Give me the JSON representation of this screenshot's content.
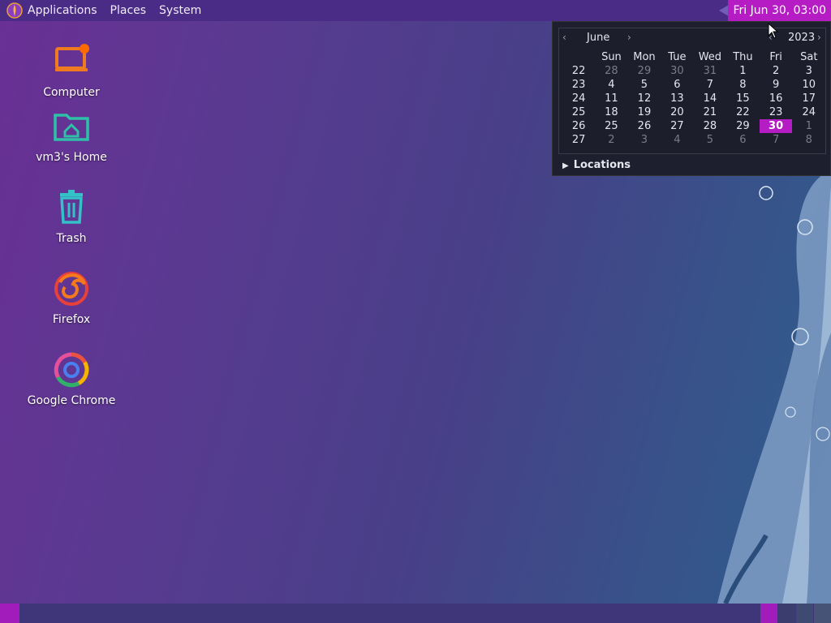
{
  "top_panel": {
    "menu": [
      "Applications",
      "Places",
      "System"
    ],
    "clock": "Fri Jun 30, 03:00"
  },
  "desktop_icons": [
    {
      "label": "Computer"
    },
    {
      "label": "vm3's Home"
    },
    {
      "label": "Trash"
    },
    {
      "label": "Firefox"
    },
    {
      "label": "Google Chrome"
    }
  ],
  "calendar": {
    "month": "June",
    "year": "2023",
    "weekdays": [
      "Sun",
      "Mon",
      "Tue",
      "Wed",
      "Thu",
      "Fri",
      "Sat"
    ],
    "weeks": [
      {
        "num": "22",
        "days": [
          "28",
          "29",
          "30",
          "31",
          "1",
          "2",
          "3"
        ]
      },
      {
        "num": "23",
        "days": [
          "4",
          "5",
          "6",
          "7",
          "8",
          "9",
          "10"
        ]
      },
      {
        "num": "24",
        "days": [
          "11",
          "12",
          "13",
          "14",
          "15",
          "16",
          "17"
        ]
      },
      {
        "num": "25",
        "days": [
          "18",
          "19",
          "20",
          "21",
          "22",
          "23",
          "24"
        ]
      },
      {
        "num": "26",
        "days": [
          "25",
          "26",
          "27",
          "28",
          "29",
          "30",
          "1"
        ]
      },
      {
        "num": "27",
        "days": [
          "2",
          "3",
          "4",
          "5",
          "6",
          "7",
          "8"
        ]
      }
    ],
    "selected_day": "30",
    "locations_label": "Locations"
  },
  "colors": {
    "panel": "#4a2b86",
    "accent": "#b51cc4",
    "popup_bg": "#1d1f2e"
  }
}
